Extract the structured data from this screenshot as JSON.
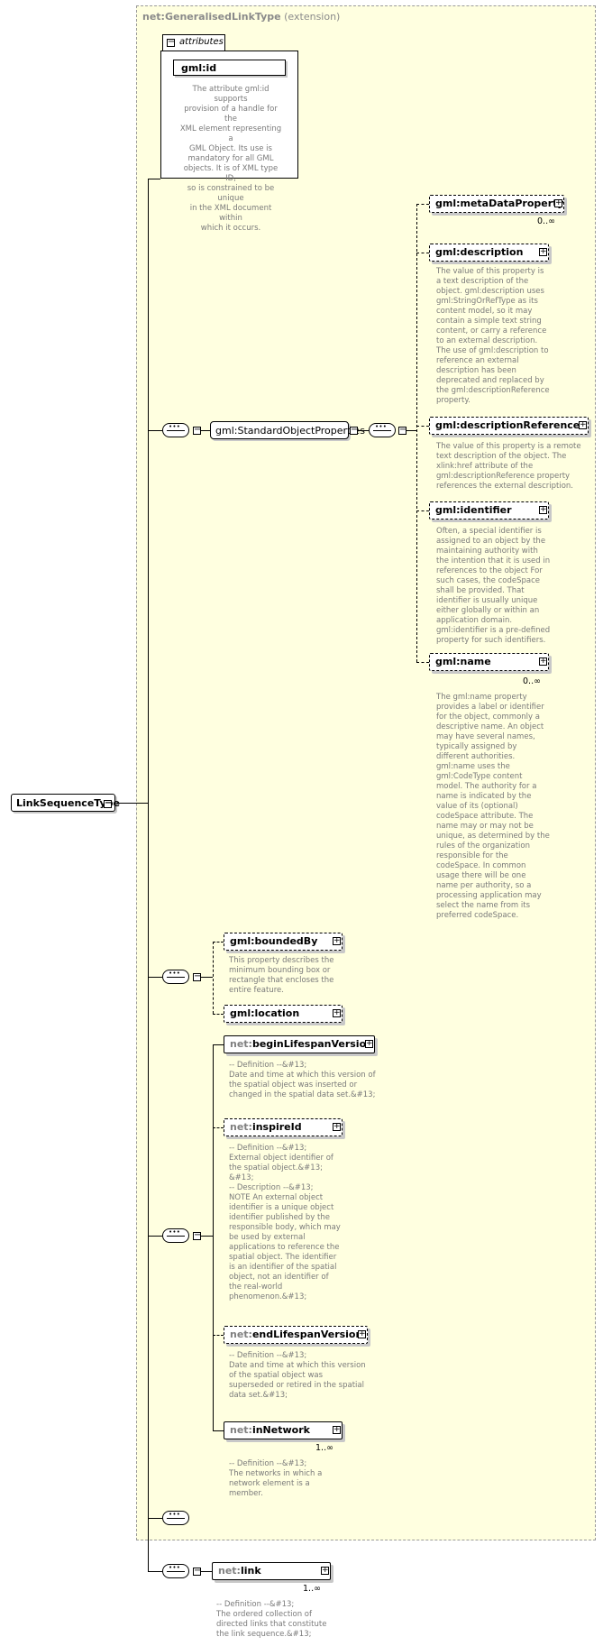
{
  "root": {
    "label": "LinkSequenceType"
  },
  "extension": {
    "prefix": "net:GeneralisedLinkType",
    "suffix": "(extension)"
  },
  "attributes": {
    "tab_label": "attributes",
    "gml_id": {
      "label": "gml:id",
      "desc": "The attribute gml:id supports\nprovision of a handle for the\nXML element representing a\nGML Object. Its use is\nmandatory for all GML\nobjects. It is of XML type ID,\nso is constrained to be unique\nin the XML document within\nwhich it occurs."
    }
  },
  "group": {
    "label": "gml:StandardObjectProperties"
  },
  "elements": {
    "metaDataProperty": {
      "label": "gml:metaDataProperty",
      "card": "0..∞"
    },
    "description": {
      "label": "gml:description",
      "desc": "The value of this property is\na text description of the\nobject. gml:description uses\ngml:StringOrRefType as its\ncontent model, so it may\ncontain a simple text string\ncontent, or carry a reference\nto an external description.\nThe use of gml:description to\nreference an external\ndescription has been\ndeprecated and replaced by\nthe gml:descriptionReference\nproperty."
    },
    "descriptionReference": {
      "label": "gml:descriptionReference",
      "desc": "The value of this property is a remote\ntext description of the object. The\nxlink:href attribute of the\ngml:descriptionReference property\nreferences the external description."
    },
    "identifier": {
      "label": "gml:identifier",
      "desc": "Often, a special identifier is\nassigned to an object by the\nmaintaining authority with\nthe intention that it is used in\nreferences to the object For\nsuch cases, the codeSpace\nshall be provided. That\nidentifier is usually unique\neither globally or within an\napplication domain.\ngml:identifier is a pre-defined\nproperty for such identifiers."
    },
    "name": {
      "label": "gml:name",
      "card": "0..∞",
      "desc": "The gml:name property\nprovides a label or identifier\nfor the object, commonly a\ndescriptive name. An object\nmay have several names,\ntypically assigned by\ndifferent authorities.\ngml:name uses the\ngml:CodeType content\nmodel.  The authority for a\nname is indicated by the\nvalue of its (optional)\ncodeSpace attribute.  The\nname may or may not be\nunique, as determined by the\nrules of the organization\nresponsible for the\ncodeSpace.  In common\nusage there will be one\nname per authority, so a\nprocessing application may\nselect the name from its\npreferred codeSpace."
    },
    "boundedBy": {
      "label": "gml:boundedBy",
      "desc": "This property describes the\nminimum bounding box or\nrectangle that encloses the\nentire feature."
    },
    "location": {
      "label": "gml:location"
    },
    "beginLifespanVersion": {
      "prefix": "net:",
      "name": "beginLifespanVersion",
      "desc": "-- Definition --&#13;\nDate and time at which this version of\nthe spatial object was inserted or\nchanged in the spatial data set.&#13;"
    },
    "inspireId": {
      "prefix": "net:",
      "name": "inspireId",
      "desc": "-- Definition --&#13;\nExternal object identifier of\nthe spatial object.&#13;\n&#13;\n-- Description --&#13;\nNOTE An external object\nidentifier is a unique object\nidentifier published by the\nresponsible body, which may\nbe used by external\napplications to reference the\nspatial object. The identifier\nis an identifier of the spatial\nobject, not an identifier of\nthe real-world\nphenomenon.&#13;"
    },
    "endLifespanVersion": {
      "prefix": "net:",
      "name": "endLifespanVersion",
      "desc": "-- Definition --&#13;\nDate and time at which this version\nof the spatial object was\nsuperseded or retired in the spatial\ndata set.&#13;"
    },
    "inNetwork": {
      "prefix": "net:",
      "name": "inNetwork",
      "card": "1..∞",
      "desc": "-- Definition --&#13;\nThe networks in which a\nnetwork element is a\nmember."
    },
    "link": {
      "prefix": "net:",
      "name": "link",
      "card": "1..∞",
      "desc": "-- Definition --&#13;\nThe ordered collection of\ndirected links that constitute\nthe link sequence.&#13;"
    }
  }
}
